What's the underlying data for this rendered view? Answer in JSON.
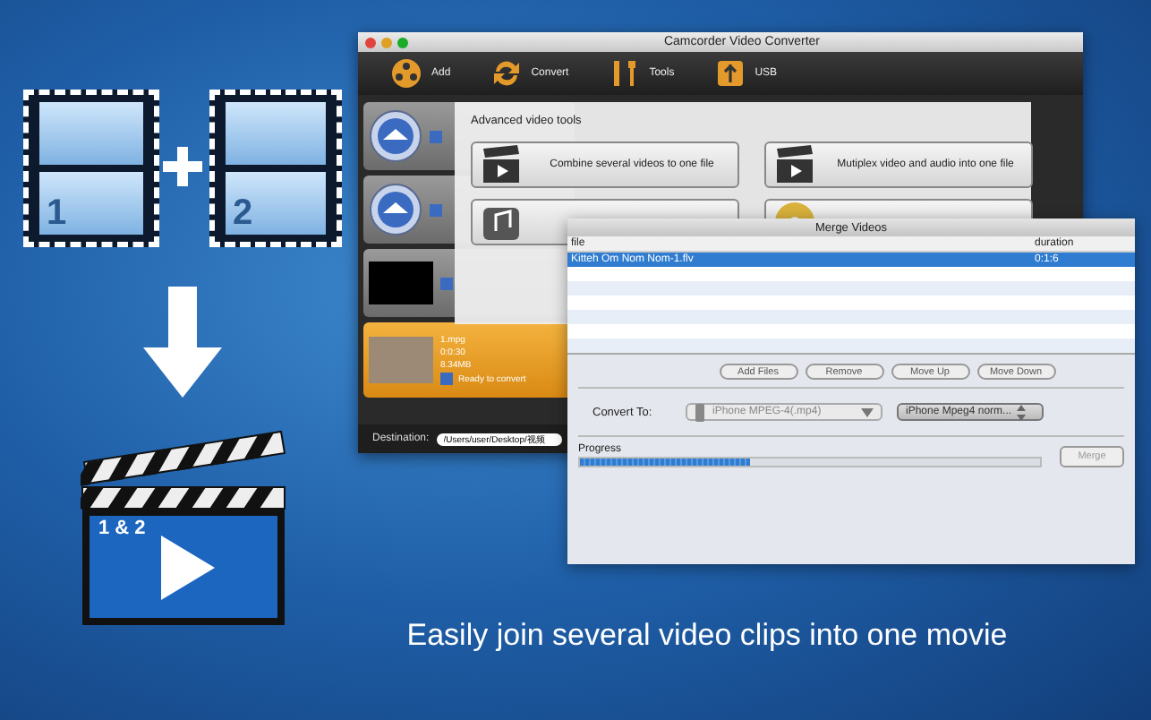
{
  "artwork": {
    "strip_labels": [
      "1",
      "2"
    ],
    "clapper_label": "1 & 2"
  },
  "caption": "Easily join several video clips into one movie",
  "main_window": {
    "title": "Camcorder Video Converter",
    "toolbar": [
      {
        "label": "Add",
        "kind": "reel"
      },
      {
        "label": "Convert",
        "kind": "convert"
      },
      {
        "label": "Tools",
        "kind": "tools"
      },
      {
        "label": "USB",
        "kind": "usb"
      }
    ],
    "items": [
      {
        "kind": "disc",
        "selected": false,
        "checked": true
      },
      {
        "kind": "disc",
        "selected": false,
        "checked": true
      },
      {
        "kind": "black",
        "selected": false,
        "checked": true
      },
      {
        "kind": "photo",
        "selected": true,
        "checked": true,
        "name": "1.mpg",
        "duration": "0:0:30",
        "size": "8.34MB",
        "status": "Ready to convert"
      }
    ],
    "destination": {
      "label": "Destination:",
      "value": "/Users/user/Desktop/视频"
    }
  },
  "tools_panel": {
    "title": "Advanced video tools",
    "buttons": [
      {
        "label": "Combine several videos to one file",
        "kind": "clapper"
      },
      {
        "label": "Mutiplex video and audio into one file",
        "kind": "clapper"
      },
      {
        "kind": "music"
      },
      {
        "kind": "disc"
      }
    ]
  },
  "merge_window": {
    "title": "Merge Videos",
    "columns": [
      "file",
      "duration"
    ],
    "rows": [
      {
        "file": "Kitteh Om Nom Nom-1.flv",
        "duration": "0:1:6",
        "selected": true
      }
    ],
    "buttons": [
      "Add Files",
      "Remove",
      "Move Up",
      "Move Down"
    ],
    "convert_label": "Convert To:",
    "format": "iPhone MPEG-4(.mp4)",
    "preset": "iPhone Mpeg4 norm...",
    "progress": {
      "label": "Progress",
      "level": 0.37
    },
    "merge_button": {
      "label": "Merge",
      "disabled": true
    }
  }
}
